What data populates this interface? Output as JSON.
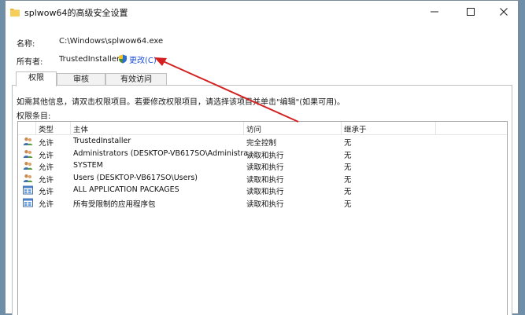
{
  "window": {
    "title": "splwow64的高级安全设置"
  },
  "fields": {
    "name_label": "名称:",
    "name_value": "C:\\Windows\\splwow64.exe",
    "owner_label": "所有者:",
    "owner_value": "TrustedInstaller",
    "change_label": "更改(C)"
  },
  "tabs": [
    {
      "label": "权限"
    },
    {
      "label": "审核"
    },
    {
      "label": "有效访问"
    }
  ],
  "info_text": "如需其他信息，请双击权限项目。若要修改权限项目，请选择该项目并单击\"编辑\"(如果可用)。",
  "entries_label": "权限条目:",
  "table": {
    "headers": {
      "type": "类型",
      "principal": "主体",
      "access": "访问",
      "inherited": "继承于"
    },
    "rows": [
      {
        "icon": "user-group-icon",
        "type": "允许",
        "principal": "TrustedInstaller",
        "access": "完全控制",
        "inherited": "无"
      },
      {
        "icon": "user-group-icon",
        "type": "允许",
        "principal": "Administrators (DESKTOP-VB617SO\\Administra...",
        "access": "读取和执行",
        "inherited": "无"
      },
      {
        "icon": "user-group-icon",
        "type": "允许",
        "principal": "SYSTEM",
        "access": "读取和执行",
        "inherited": "无"
      },
      {
        "icon": "user-group-icon",
        "type": "允许",
        "principal": "Users (DESKTOP-VB617SO\\Users)",
        "access": "读取和执行",
        "inherited": "无"
      },
      {
        "icon": "app-package-icon",
        "type": "允许",
        "principal": "ALL APPLICATION PACKAGES",
        "access": "读取和执行",
        "inherited": "无"
      },
      {
        "icon": "app-package-icon",
        "type": "允许",
        "principal": "所有受限制的应用程序包",
        "access": "读取和执行",
        "inherited": "无"
      }
    ]
  },
  "colors": {
    "link": "#1f4fd6",
    "annotation_arrow": "#d42020",
    "desktop": "#6f8fa9"
  }
}
